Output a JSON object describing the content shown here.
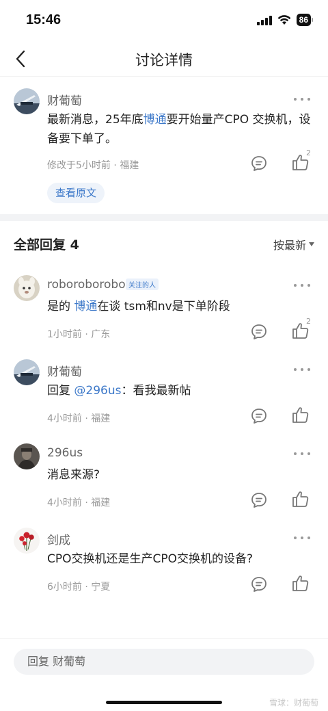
{
  "status_bar": {
    "time": "15:46",
    "battery": "86"
  },
  "nav": {
    "title": "讨论详情"
  },
  "main_post": {
    "author": "财葡萄",
    "text_before": "最新消息，25年底",
    "link": "博通",
    "text_after": "要开始量产CPO 交换机，设备要下单了。",
    "meta": "修改于5小时前 · 福建",
    "like_count": "2",
    "view_original": "查看原文"
  },
  "replies_header": {
    "title": "全部回复 4",
    "sort": "按最新"
  },
  "replies": [
    {
      "author": "roboroborobo",
      "tag": "关注的人",
      "text_before": "是的 ",
      "link": "博通",
      "text_after": "在谈 tsm和nv是下单阶段",
      "meta": "1小时前 · 广东",
      "like_count": "2"
    },
    {
      "author": "财葡萄",
      "text_before": "回复 ",
      "link": "@296us",
      "text_after": "：看我最新帖",
      "meta": "4小时前 · 福建",
      "like_count": ""
    },
    {
      "author": "296us",
      "text": "消息来源?",
      "meta": "4小时前 · 福建",
      "like_count": ""
    },
    {
      "author": "剑成",
      "text": "CPO交换机还是生产CPO交换机的设备?",
      "meta": "6小时前 · 宁夏",
      "like_count": ""
    }
  ],
  "bottom": {
    "reply_placeholder": "回复 财葡萄",
    "watermark": "雪球：财葡萄"
  },
  "icons": {
    "back": "chevron-left-icon",
    "more": "more-icon",
    "comment": "comment-icon",
    "like": "thumbs-up-icon"
  }
}
